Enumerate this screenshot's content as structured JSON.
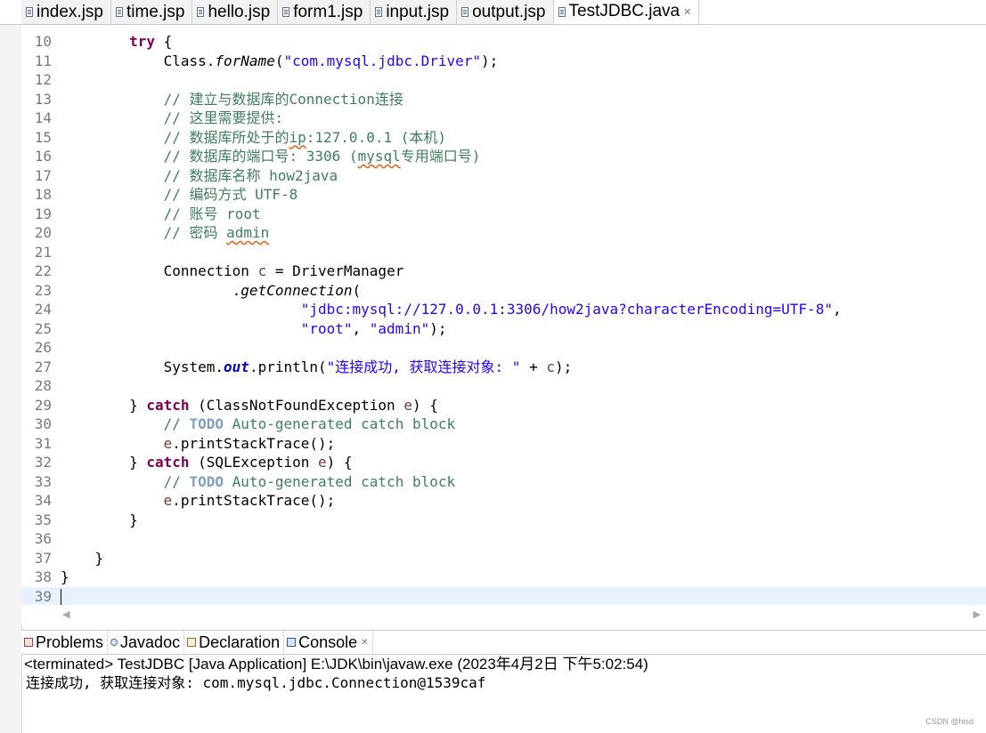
{
  "editor_tabs": [
    {
      "label": "index.jsp"
    },
    {
      "label": "time.jsp"
    },
    {
      "label": "hello.jsp"
    },
    {
      "label": "form1.jsp"
    },
    {
      "label": "input.jsp"
    },
    {
      "label": "output.jsp"
    },
    {
      "label": "TestJDBC.java",
      "active": true
    }
  ],
  "code": {
    "lines": [
      {
        "n": "10"
      },
      {
        "n": "11"
      },
      {
        "n": "12"
      },
      {
        "n": "13"
      },
      {
        "n": "14"
      },
      {
        "n": "15"
      },
      {
        "n": "16"
      },
      {
        "n": "17"
      },
      {
        "n": "18"
      },
      {
        "n": "19"
      },
      {
        "n": "20"
      },
      {
        "n": "21"
      },
      {
        "n": "22"
      },
      {
        "n": "23"
      },
      {
        "n": "24"
      },
      {
        "n": "25"
      },
      {
        "n": "26"
      },
      {
        "n": "27"
      },
      {
        "n": "28"
      },
      {
        "n": "29"
      },
      {
        "n": "30"
      },
      {
        "n": "31"
      },
      {
        "n": "32"
      },
      {
        "n": "33"
      },
      {
        "n": "34"
      },
      {
        "n": "35"
      },
      {
        "n": "36"
      },
      {
        "n": "37"
      },
      {
        "n": "38"
      },
      {
        "n": "39"
      }
    ],
    "t": {
      "try": "try",
      "brace_open": " {",
      "class_call_a": "Class.",
      "forName": "forName",
      "paren_open": "(",
      "driver_str": "\"com.mysql.jdbc.Driver\"",
      "paren_close_semi": ");",
      "c13": "// 建立与数据库的Connection连接",
      "c14": "// 这里需要提供:",
      "c15a": "// 数据库所处于的",
      "c15b": "ip",
      "c15c": ":127.0.0.1 (本机)",
      "c16a": "// 数据库的端口号: 3306 (",
      "c16b": "mysql",
      "c16c": "专用端口号)",
      "c17": "// 数据库名称 how2java",
      "c18": "// 编码方式 UTF-8",
      "c19": "// 账号 root",
      "c20a": "// 密码 ",
      "c20b": "admin",
      "l22a": "Connection ",
      "l22b": "c",
      "l22c": " = DriverManager",
      "l23a": ".",
      "l23b": "getConnection",
      "l23c": "(",
      "url_str": "\"jdbc:mysql://127.0.0.1:3306/how2java?characterEncoding=UTF-8\"",
      "comma": ",",
      "root_str": "\"root\"",
      "comma_sp": ", ",
      "admin_str": "\"admin\"",
      "l27a": "System.",
      "l27b": "out",
      "l27c": ".println(",
      "l27d": "\"连接成功, 获取连接对象: \"",
      "l27e": " + ",
      "l27f": "c",
      "close_brace": "}",
      "catch": "catch",
      "l29a": "} ",
      "l29b": " (ClassNotFoundException ",
      "e": "e",
      "l29c": ") {",
      "todo_prefix": "// ",
      "todo": "TODO",
      "todo_rest": " Auto-generated catch block",
      "print_a": ".printStackTrace();",
      "l32b": " (SQLException ",
      "brace_only": "}"
    }
  },
  "bottom_tabs": [
    {
      "label": "Problems",
      "icon": "problems-icon"
    },
    {
      "label": "Javadoc",
      "icon": "javadoc-icon"
    },
    {
      "label": "Declaration",
      "icon": "declaration-icon"
    },
    {
      "label": "Console",
      "icon": "console-icon",
      "active": true
    }
  ],
  "console": {
    "header": "<terminated> TestJDBC [Java Application] E:\\JDK\\bin\\javaw.exe (2023年4月2日 下午5:02:54)",
    "output": "连接成功, 获取连接对象: com.mysql.jdbc.Connection@1539caf"
  },
  "watermark": "CSDN @hisd",
  "colors": {
    "keyword": "#7f0055",
    "string": "#2a00ff",
    "comment": "#3f7f5f",
    "todo": "#7f9fbf",
    "field": "#0000c0",
    "current_line": "#e8f2fe"
  }
}
